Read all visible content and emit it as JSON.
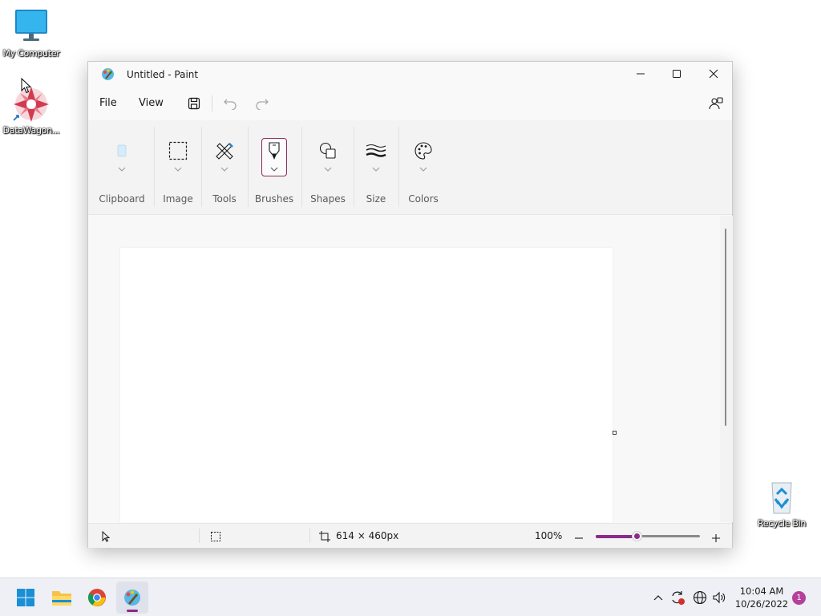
{
  "desktop": {
    "icons": [
      {
        "label": "My Computer"
      },
      {
        "label": "DataWagon..."
      },
      {
        "label": "Recycle Bin"
      }
    ]
  },
  "window": {
    "title": "Untitled - Paint",
    "menu": {
      "file": "File",
      "view": "View"
    },
    "ribbon": {
      "groups": [
        {
          "label": "Clipboard",
          "icon": "clipboard-icon"
        },
        {
          "label": "Image",
          "icon": "selection-icon"
        },
        {
          "label": "Tools",
          "icon": "pencil-icon"
        },
        {
          "label": "Brushes",
          "icon": "brush-icon"
        },
        {
          "label": "Shapes",
          "icon": "shapes-icon"
        },
        {
          "label": "Size",
          "icon": "line-size-icon"
        },
        {
          "label": "Colors",
          "icon": "palette-icon"
        }
      ]
    },
    "status": {
      "canvas_size": "614 × 460px",
      "zoom": "100%",
      "zoom_level": 0.4
    }
  },
  "taskbar": {
    "time": "10:04 AM",
    "date": "10/26/2022",
    "notification_count": "1"
  },
  "colors": {
    "accent": "#8a2a8a",
    "taskbar": "#eef0f5"
  }
}
